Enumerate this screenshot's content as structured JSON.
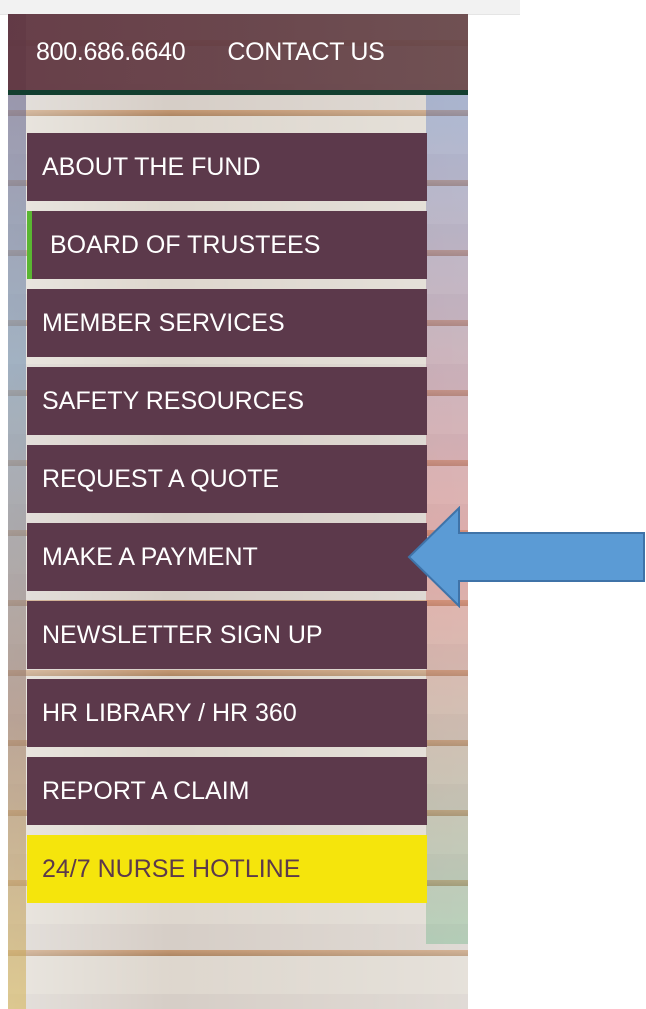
{
  "header": {
    "phone": "800.686.6640",
    "contact": "CONTACT US"
  },
  "nav": {
    "items": [
      {
        "label": "ABOUT THE FUND",
        "active": false
      },
      {
        "label": "BOARD OF TRUSTEES",
        "active": true
      },
      {
        "label": "MEMBER SERVICES",
        "active": false
      },
      {
        "label": "SAFETY RESOURCES",
        "active": false
      },
      {
        "label": "REQUEST A QUOTE",
        "active": false
      },
      {
        "label": "MAKE A PAYMENT",
        "active": false
      },
      {
        "label": "NEWSLETTER SIGN UP",
        "active": false
      },
      {
        "label": "HR LIBRARY / HR 360",
        "active": false
      },
      {
        "label": "REPORT A CLAIM",
        "active": false
      },
      {
        "label": "24/7 NURSE HOTLINE",
        "active": false
      }
    ]
  },
  "annotation": {
    "icon": "arrow-left-icon",
    "color": "#5b9bd5",
    "outline": "#3f73a8"
  },
  "colors": {
    "nav_background": "#5a3a4a",
    "active_border": "#60b33b",
    "hotline_background": "#f2e41f",
    "top_border": "#163d2f"
  }
}
